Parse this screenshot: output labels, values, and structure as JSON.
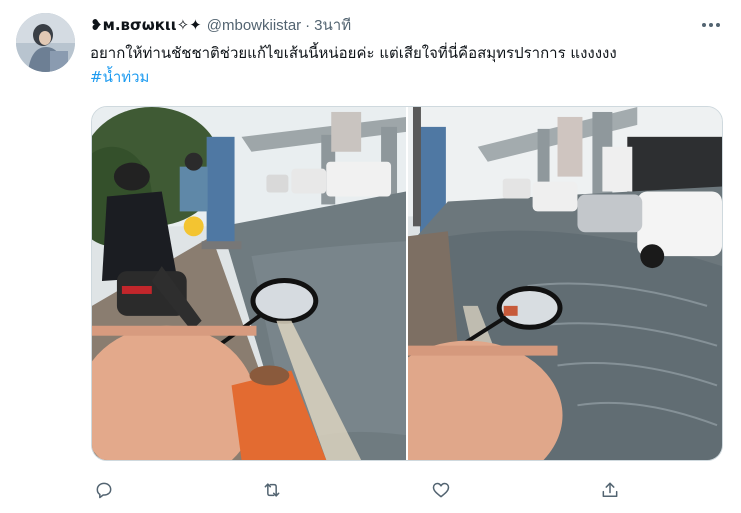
{
  "tweet": {
    "display_name": "❥м.вσωкιι✧✦",
    "handle": "@mbowkiistar",
    "separator": "·",
    "timestamp": "3นาที",
    "text": "อยากให้ท่านชัชชาติช่วยแก้ไขเส้นนี้หน่อยค่ะ  แต่เสียใจที่นี่คือสมุทรปราการ แงงงงง",
    "hashtag": "#น้ำท่วม",
    "media": [
      {
        "alt": "flooded-street-photo-left"
      },
      {
        "alt": "flooded-street-photo-right"
      }
    ]
  },
  "icons": {
    "more": "more-horizontal-icon",
    "reply": "reply-icon",
    "retweet": "retweet-icon",
    "like": "like-icon",
    "share": "share-icon"
  },
  "colors": {
    "link": "#1d9bf0",
    "secondary_text": "#536471",
    "border": "#cfd9de"
  }
}
